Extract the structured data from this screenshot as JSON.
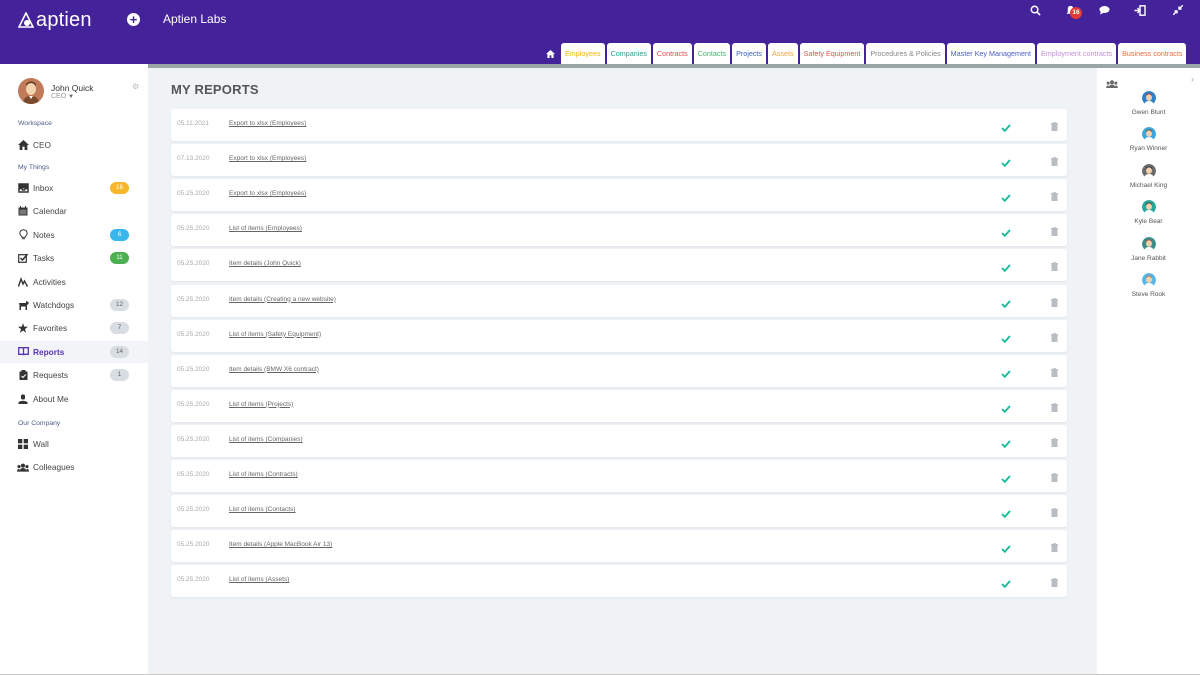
{
  "header": {
    "logo_text": "aptien",
    "org_name": "Aptien Labs",
    "icons": [
      "plus-circle-icon",
      "search-icon",
      "bell-icon",
      "chat-icon",
      "logout-icon",
      "collapse-icon"
    ],
    "notification_count": "16"
  },
  "tabs": [
    {
      "label": "Employees",
      "color": "#f2b705"
    },
    {
      "label": "Companies",
      "color": "#2a9d8f"
    },
    {
      "label": "Contracts",
      "color": "#e5484d"
    },
    {
      "label": "Contacts",
      "color": "#3fb66b"
    },
    {
      "label": "Projects",
      "color": "#3c63c4"
    },
    {
      "label": "Assets",
      "color": "#f4a340"
    },
    {
      "label": "Safety Equipment",
      "color": "#e05252"
    },
    {
      "label": "Procedures & Policies",
      "color": "#888888"
    },
    {
      "label": "Master Key Management",
      "color": "#4a5fc8"
    },
    {
      "label": "Employment contracts",
      "color": "#c58fd8"
    },
    {
      "label": "Business contracts",
      "color": "#ef6a3d"
    }
  ],
  "profile": {
    "name": "John Quick",
    "role": "CEO"
  },
  "sidebar": {
    "workspace_label": "Workspace",
    "workspace_item": {
      "label": "CEO",
      "icon": "home-icon"
    },
    "my_things_label": "My Things",
    "items": [
      {
        "label": "Inbox",
        "icon": "inbox-icon",
        "badge": "16",
        "badge_color": "#f8b62b"
      },
      {
        "label": "Calendar",
        "icon": "calendar-icon",
        "badge": null
      },
      {
        "label": "Notes",
        "icon": "lightbulb-icon",
        "badge": "6",
        "badge_color": "#39b6ec"
      },
      {
        "label": "Tasks",
        "icon": "checkbox-icon",
        "badge": "11",
        "badge_color": "#4caf50"
      },
      {
        "label": "Activities",
        "icon": "activity-icon",
        "badge": null
      },
      {
        "label": "Watchdogs",
        "icon": "dog-icon",
        "badge": "12",
        "badge_color": "#d7dde2"
      },
      {
        "label": "Favorites",
        "icon": "star-icon",
        "badge": "7",
        "badge_color": "#d7dde2"
      },
      {
        "label": "Reports",
        "icon": "book-icon",
        "badge": "14",
        "badge_color": "#d7dde2",
        "active": true
      },
      {
        "label": "Requests",
        "icon": "clipboard-icon",
        "badge": "1",
        "badge_color": "#d7dde2"
      },
      {
        "label": "About Me",
        "icon": "user-icon",
        "badge": null
      }
    ],
    "company_label": "Our Company",
    "company_items": [
      {
        "label": "Wall",
        "icon": "grid-icon"
      },
      {
        "label": "Colleagues",
        "icon": "users-icon"
      }
    ]
  },
  "main": {
    "title": "MY REPORTS",
    "reports": [
      {
        "date": "05.11.2021",
        "name": "Export to xlsx (Employees)"
      },
      {
        "date": "07.13.2020",
        "name": "Export to xlsx (Employees)"
      },
      {
        "date": "05.25.2020",
        "name": "Export to xlsx (Employees)"
      },
      {
        "date": "05.25.2020",
        "name": "List of items (Employees)"
      },
      {
        "date": "05.25.2020",
        "name": "Item details (John Quick)"
      },
      {
        "date": "05.25.2020",
        "name": "Item details (Creating a new website)"
      },
      {
        "date": "05.25.2020",
        "name": "List of items (Safety Equipment)"
      },
      {
        "date": "05.25.2020",
        "name": "Item details (BMW X6 contract)"
      },
      {
        "date": "05.25.2020",
        "name": "List of items (Projects)"
      },
      {
        "date": "05.25.2020",
        "name": "List of items (Companies)"
      },
      {
        "date": "05.25.2020",
        "name": "List of items (Contracts)"
      },
      {
        "date": "05.25.2020",
        "name": "List of items (Contacts)"
      },
      {
        "date": "05.25.2020",
        "name": "Item details (Apple MacBook Air 13)"
      },
      {
        "date": "05.25.2020",
        "name": "List of items (Assets)"
      }
    ]
  },
  "colleagues": [
    {
      "name": "Gwen Blunt",
      "hair": "#b0392e",
      "bg": "#2f80c9"
    },
    {
      "name": "Ryan Winner",
      "hair": "#6a4a2b",
      "bg": "#39a7e0"
    },
    {
      "name": "Michael King",
      "hair": "#2b2b2b",
      "bg": "#6b6b6b"
    },
    {
      "name": "Kyle Bear",
      "hair": "#4a3426",
      "bg": "#25a89a"
    },
    {
      "name": "Jane Rabbit",
      "hair": "#b24a2c",
      "bg": "#3a8f8a"
    },
    {
      "name": "Steve Rook",
      "hair": "#a8713c",
      "bg": "#5ab7ea"
    }
  ]
}
